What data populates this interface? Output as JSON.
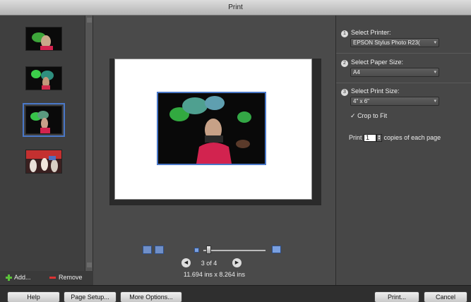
{
  "window": {
    "title": "Print"
  },
  "sidebar": {
    "add_label": "Add...",
    "remove_label": "Remove"
  },
  "preview": {
    "page_indicator": "3 of 4",
    "page_size_text": "11.694 ins x 8.264 ins"
  },
  "settings": {
    "printer_step": "1",
    "printer_label": "Select Printer:",
    "printer_value": "EPSON Stylus Photo R23(",
    "paper_step": "2",
    "paper_label": "Select Paper Size:",
    "paper_value": "A4",
    "print_size_step": "3",
    "print_size_label": "Select Print Size:",
    "print_size_value": "4\" x 6\"",
    "crop_label": "Crop to Fit",
    "crop_checked": true,
    "copies_prefix": "Print",
    "copies_value": "1",
    "copies_suffix": "copies of each page"
  },
  "footer": {
    "help_label": "Help",
    "page_setup_label": "Page Setup...",
    "more_options_label": "More Options...",
    "print_label": "Print...",
    "cancel_label": "Cancel"
  },
  "colors": {
    "selection": "#4a78c8",
    "add": "#5bc23a",
    "remove": "#dd3333"
  }
}
